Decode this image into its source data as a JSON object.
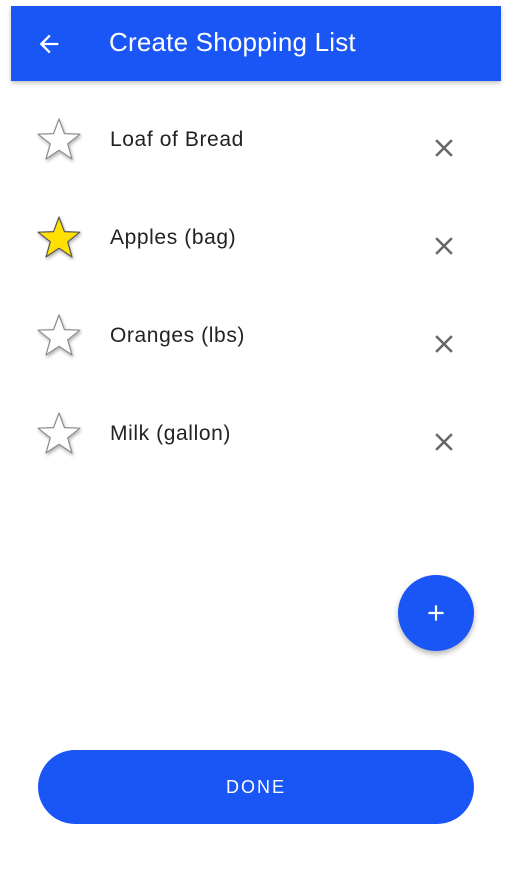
{
  "app_bar": {
    "title": "Create Shopping List",
    "back_icon": "arrow-back-icon"
  },
  "colors": {
    "primary": "#1a56f5",
    "star_filled": "#ffe000",
    "star_outline": "#ffffff",
    "remove_icon": "#666666",
    "text": "#222222"
  },
  "items": [
    {
      "label": "Loaf of Bread",
      "starred": false,
      "star_icon": "star-outline-icon",
      "remove_icon": "close-icon"
    },
    {
      "label": "Apples (bag)",
      "starred": true,
      "star_icon": "star-filled-icon",
      "remove_icon": "close-icon"
    },
    {
      "label": "Oranges (lbs)",
      "starred": false,
      "star_icon": "star-outline-icon",
      "remove_icon": "close-icon"
    },
    {
      "label": "Milk (gallon)",
      "starred": false,
      "star_icon": "star-outline-icon",
      "remove_icon": "close-icon"
    }
  ],
  "fab": {
    "icon": "plus-icon"
  },
  "done_button": {
    "label": "DONE"
  }
}
